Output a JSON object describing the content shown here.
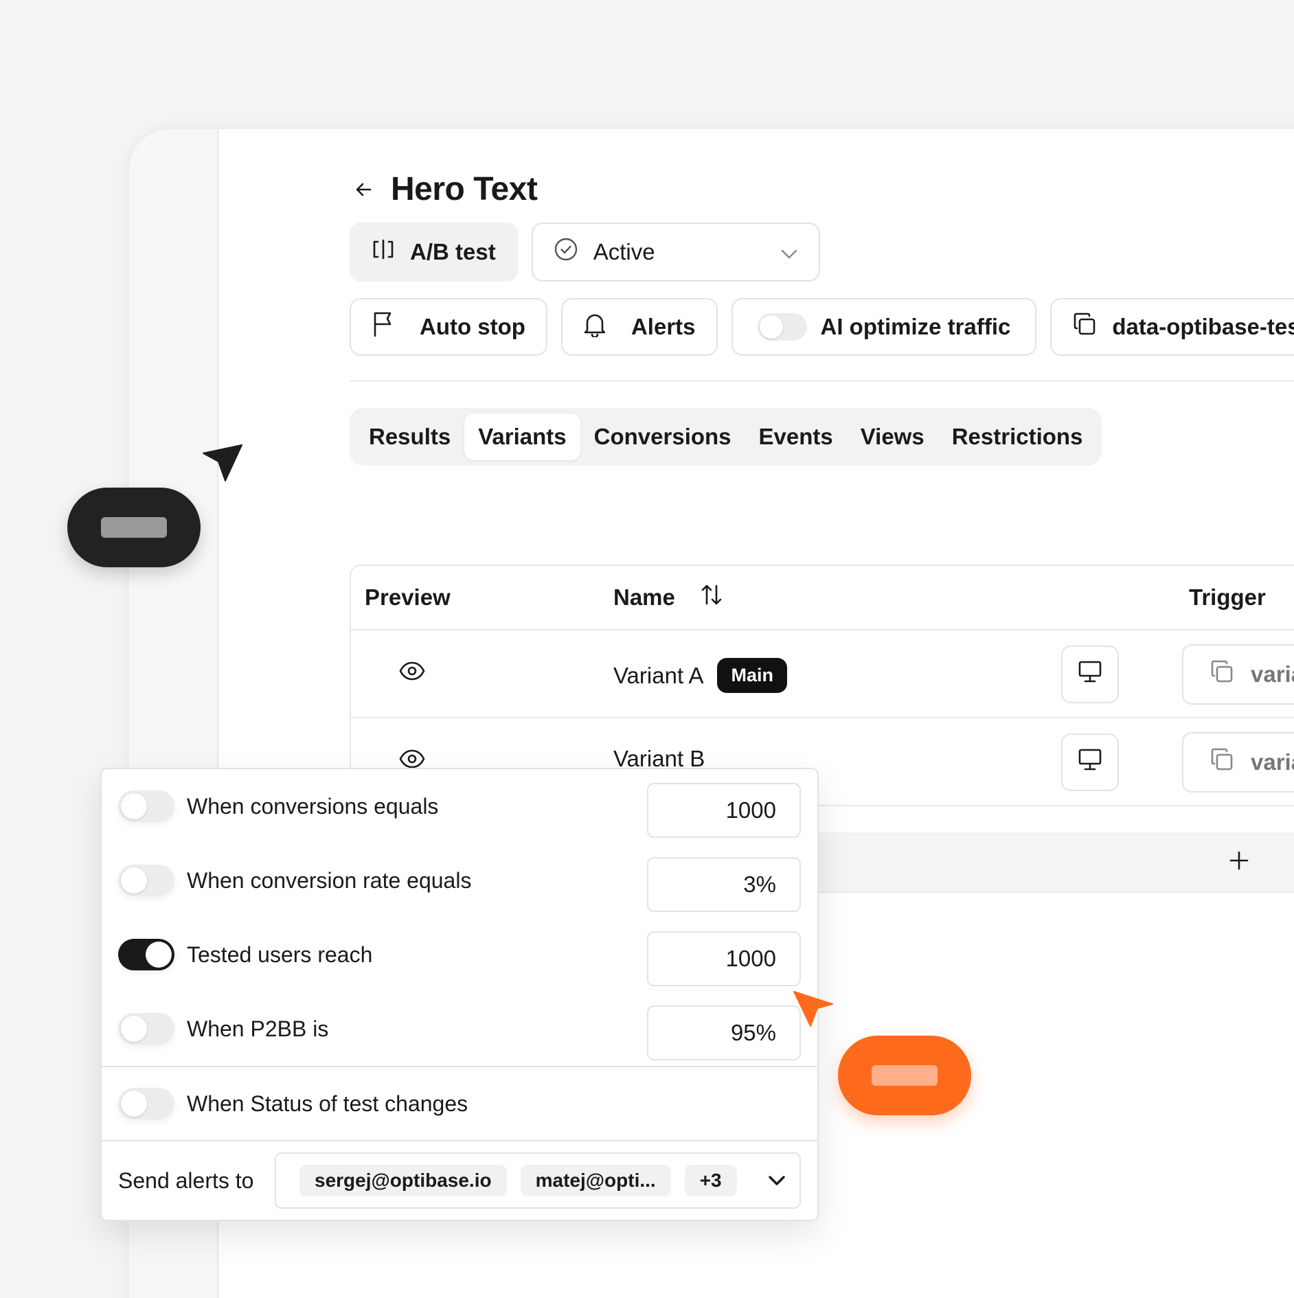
{
  "page": {
    "title": "Hero Text",
    "test_type": "A/B test",
    "status": "Active"
  },
  "toolbar": {
    "auto_stop": "Auto stop",
    "alerts": "Alerts",
    "ai_optimize": "AI optimize traffic",
    "ai_optimize_enabled": false,
    "code_snippet": "data-optibase-test-id=\"p"
  },
  "tabs": [
    {
      "label": "Results",
      "active": false
    },
    {
      "label": "Variants",
      "active": true
    },
    {
      "label": "Conversions",
      "active": false
    },
    {
      "label": "Events",
      "active": false
    },
    {
      "label": "Views",
      "active": false
    },
    {
      "label": "Restrictions",
      "active": false
    }
  ],
  "table": {
    "headers": {
      "preview": "Preview",
      "name": "Name",
      "trigger": "Trigger"
    },
    "rows": [
      {
        "name": "Variant A",
        "badge": "Main",
        "trigger": "variant_a"
      },
      {
        "name": "Variant B",
        "badge": "",
        "trigger": "variant_b"
      }
    ]
  },
  "alerts_panel": {
    "rules": [
      {
        "label": "When conversions equals",
        "value": "1000",
        "enabled": false
      },
      {
        "label": "When conversion rate equals",
        "value": "3%",
        "enabled": false
      },
      {
        "label": "Tested users reach",
        "value": "1000",
        "enabled": true
      },
      {
        "label": "When P2BB is",
        "value": "95%",
        "enabled": false
      }
    ],
    "status_rule": {
      "label": "When Status of test changes",
      "enabled": false
    },
    "send_to": {
      "label": "Send alerts to",
      "emails": [
        "sergej@optibase.io",
        "matej@opti..."
      ],
      "more": "+3"
    }
  },
  "colors": {
    "accent_dark": "#1a1a1a",
    "accent_orange": "#fe6a1c"
  }
}
